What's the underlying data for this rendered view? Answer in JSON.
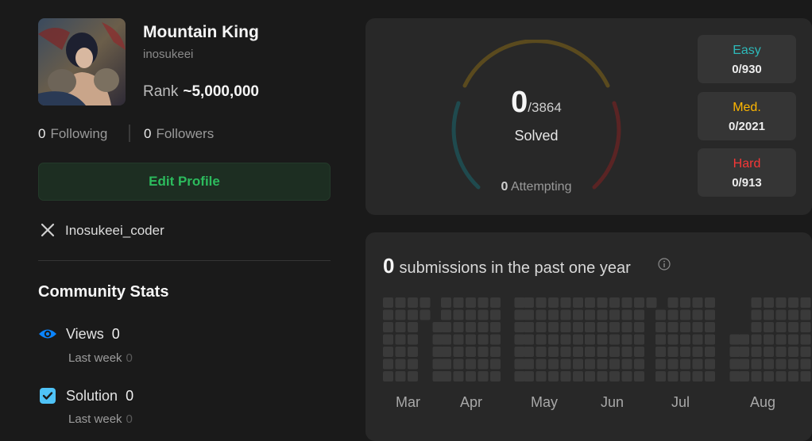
{
  "profile": {
    "name": "Mountain King",
    "username": "inosukeei",
    "rank_label": "Rank",
    "rank_value": "~5,000,000",
    "following_count": "0",
    "following_label": "Following",
    "followers_count": "0",
    "followers_label": "Followers",
    "edit_button": "Edit Profile",
    "x_handle": "Inosukeei_coder"
  },
  "community": {
    "title": "Community Stats",
    "stats": [
      {
        "label": "Views",
        "value": "0",
        "sub_label": "Last week",
        "sub_value": "0",
        "icon": "eye-icon"
      },
      {
        "label": "Solution",
        "value": "0",
        "sub_label": "Last week",
        "sub_value": "0",
        "icon": "checkbox-icon"
      }
    ]
  },
  "solved": {
    "count": "0",
    "total": "/3864",
    "label": "Solved",
    "attempting_count": "0",
    "attempting_label": "Attempting",
    "difficulties": [
      {
        "label": "Easy",
        "value": "0/930",
        "color": "#2db9b9"
      },
      {
        "label": "Med.",
        "value": "0/2021",
        "color": "#ffb700"
      },
      {
        "label": "Hard",
        "value": "0/913",
        "color": "#f63737"
      }
    ]
  },
  "submissions": {
    "count": "0",
    "text": "submissions in the past one year",
    "months": [
      "Mar",
      "Apr",
      "May",
      "Jun",
      "Jul",
      "Aug"
    ]
  },
  "colors": {
    "accent_green": "#2cbb5d",
    "background": "#1a1a1a",
    "card": "#282828",
    "heat_empty": "#3a3a3a"
  }
}
